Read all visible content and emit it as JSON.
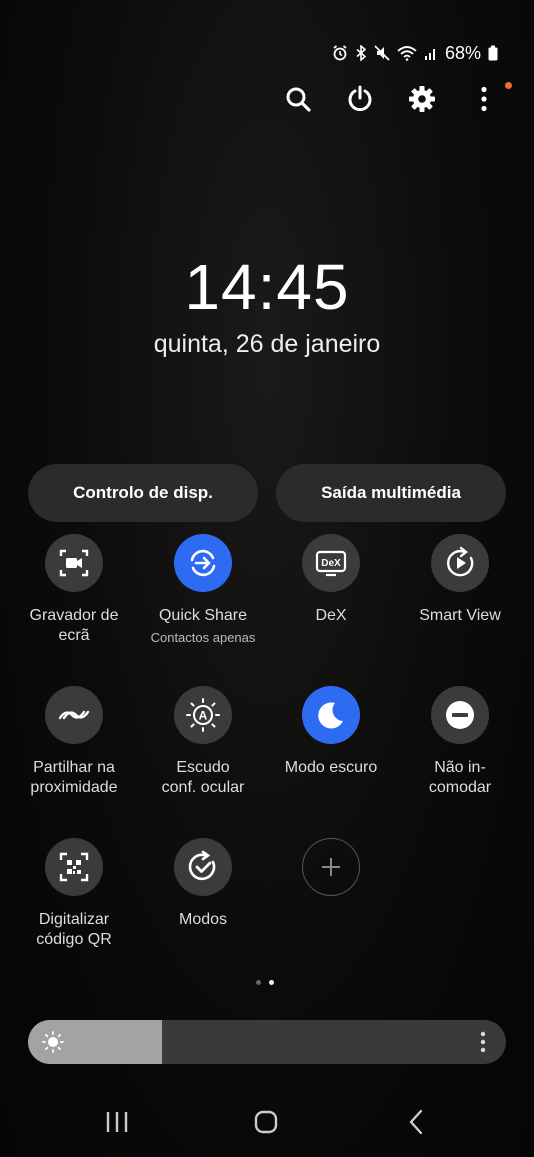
{
  "status_bar": {
    "battery_percent": "68%",
    "icons": [
      "alarm-icon",
      "bluetooth-icon",
      "mute-icon",
      "wifi-icon",
      "signal-icon",
      "battery-icon"
    ]
  },
  "top_actions": [
    "search-icon",
    "power-icon",
    "settings-icon",
    "more-options-icon"
  ],
  "notification_dot_color": "#f06a3a",
  "clock": {
    "time": "14:45",
    "date": "quinta, 26 de janeiro"
  },
  "pills": {
    "device_control": "Controlo de disp.",
    "media_output": "Saída multimédia"
  },
  "tiles": [
    {
      "label": "Gravador de\necrã",
      "icon": "screen-recorder-icon",
      "active": false
    },
    {
      "label": "Quick Share",
      "sublabel": "Contactos apenas",
      "icon": "quick-share-icon",
      "active": true
    },
    {
      "label": "DeX",
      "icon": "dex-icon",
      "icon_text": "DeX",
      "active": false
    },
    {
      "label": "Smart View",
      "icon": "smart-view-icon",
      "active": false
    },
    {
      "label": "Partilhar na\nproximidade",
      "icon": "nearby-share-icon",
      "active": false
    },
    {
      "label": "Escudo\nconf. ocular",
      "icon": "eye-comfort-icon",
      "icon_text": "A",
      "active": false
    },
    {
      "label": "Modo escuro",
      "icon": "moon-icon",
      "active": true
    },
    {
      "label": "Não in-\ncomodar",
      "icon": "do-not-disturb-icon",
      "active": false
    },
    {
      "label": "Digitalizar\ncódigo QR",
      "icon": "qr-scanner-icon",
      "active": false
    },
    {
      "label": "Modos",
      "icon": "modes-icon",
      "active": false
    },
    {
      "label": "",
      "icon": "add-icon",
      "active": false
    }
  ],
  "page_indicator": {
    "pages": 2,
    "current": 2
  },
  "brightness": {
    "level_fraction": 0.28
  },
  "nav_bar": [
    "recents-icon",
    "home-icon",
    "back-icon"
  ],
  "colors": {
    "accent": "#2e6bf3",
    "tile_bg": "#3b3b3b",
    "pill_bg": "#2b2b2b"
  }
}
